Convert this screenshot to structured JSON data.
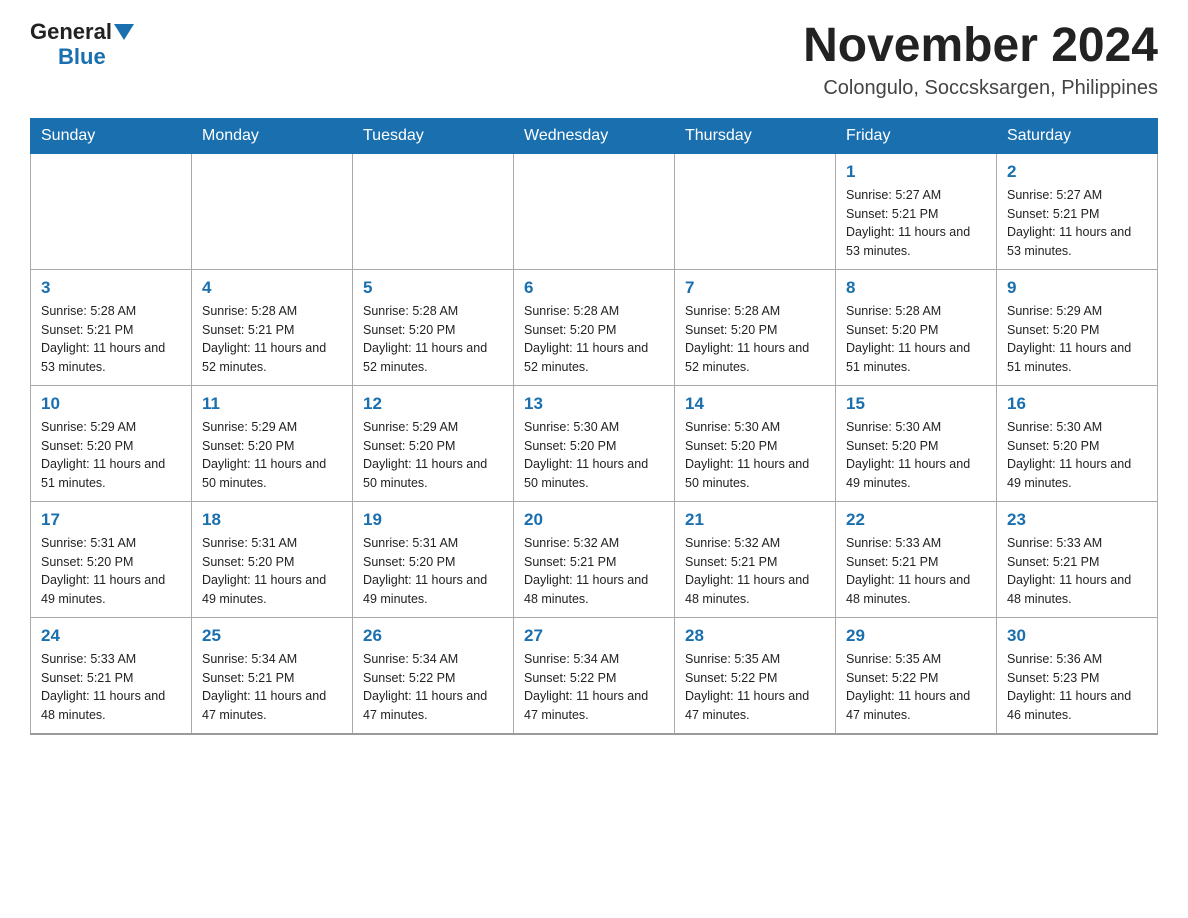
{
  "header": {
    "logo": {
      "general": "General",
      "triangle_alt": "blue triangle",
      "blue": "Blue"
    },
    "title": "November 2024",
    "location": "Colongulo, Soccsksargen, Philippines"
  },
  "calendar": {
    "days_of_week": [
      "Sunday",
      "Monday",
      "Tuesday",
      "Wednesday",
      "Thursday",
      "Friday",
      "Saturday"
    ],
    "weeks": [
      [
        {
          "day": "",
          "sunrise": "",
          "sunset": "",
          "daylight": ""
        },
        {
          "day": "",
          "sunrise": "",
          "sunset": "",
          "daylight": ""
        },
        {
          "day": "",
          "sunrise": "",
          "sunset": "",
          "daylight": ""
        },
        {
          "day": "",
          "sunrise": "",
          "sunset": "",
          "daylight": ""
        },
        {
          "day": "",
          "sunrise": "",
          "sunset": "",
          "daylight": ""
        },
        {
          "day": "1",
          "sunrise": "Sunrise: 5:27 AM",
          "sunset": "Sunset: 5:21 PM",
          "daylight": "Daylight: 11 hours and 53 minutes."
        },
        {
          "day": "2",
          "sunrise": "Sunrise: 5:27 AM",
          "sunset": "Sunset: 5:21 PM",
          "daylight": "Daylight: 11 hours and 53 minutes."
        }
      ],
      [
        {
          "day": "3",
          "sunrise": "Sunrise: 5:28 AM",
          "sunset": "Sunset: 5:21 PM",
          "daylight": "Daylight: 11 hours and 53 minutes."
        },
        {
          "day": "4",
          "sunrise": "Sunrise: 5:28 AM",
          "sunset": "Sunset: 5:21 PM",
          "daylight": "Daylight: 11 hours and 52 minutes."
        },
        {
          "day": "5",
          "sunrise": "Sunrise: 5:28 AM",
          "sunset": "Sunset: 5:20 PM",
          "daylight": "Daylight: 11 hours and 52 minutes."
        },
        {
          "day": "6",
          "sunrise": "Sunrise: 5:28 AM",
          "sunset": "Sunset: 5:20 PM",
          "daylight": "Daylight: 11 hours and 52 minutes."
        },
        {
          "day": "7",
          "sunrise": "Sunrise: 5:28 AM",
          "sunset": "Sunset: 5:20 PM",
          "daylight": "Daylight: 11 hours and 52 minutes."
        },
        {
          "day": "8",
          "sunrise": "Sunrise: 5:28 AM",
          "sunset": "Sunset: 5:20 PM",
          "daylight": "Daylight: 11 hours and 51 minutes."
        },
        {
          "day": "9",
          "sunrise": "Sunrise: 5:29 AM",
          "sunset": "Sunset: 5:20 PM",
          "daylight": "Daylight: 11 hours and 51 minutes."
        }
      ],
      [
        {
          "day": "10",
          "sunrise": "Sunrise: 5:29 AM",
          "sunset": "Sunset: 5:20 PM",
          "daylight": "Daylight: 11 hours and 51 minutes."
        },
        {
          "day": "11",
          "sunrise": "Sunrise: 5:29 AM",
          "sunset": "Sunset: 5:20 PM",
          "daylight": "Daylight: 11 hours and 50 minutes."
        },
        {
          "day": "12",
          "sunrise": "Sunrise: 5:29 AM",
          "sunset": "Sunset: 5:20 PM",
          "daylight": "Daylight: 11 hours and 50 minutes."
        },
        {
          "day": "13",
          "sunrise": "Sunrise: 5:30 AM",
          "sunset": "Sunset: 5:20 PM",
          "daylight": "Daylight: 11 hours and 50 minutes."
        },
        {
          "day": "14",
          "sunrise": "Sunrise: 5:30 AM",
          "sunset": "Sunset: 5:20 PM",
          "daylight": "Daylight: 11 hours and 50 minutes."
        },
        {
          "day": "15",
          "sunrise": "Sunrise: 5:30 AM",
          "sunset": "Sunset: 5:20 PM",
          "daylight": "Daylight: 11 hours and 49 minutes."
        },
        {
          "day": "16",
          "sunrise": "Sunrise: 5:30 AM",
          "sunset": "Sunset: 5:20 PM",
          "daylight": "Daylight: 11 hours and 49 minutes."
        }
      ],
      [
        {
          "day": "17",
          "sunrise": "Sunrise: 5:31 AM",
          "sunset": "Sunset: 5:20 PM",
          "daylight": "Daylight: 11 hours and 49 minutes."
        },
        {
          "day": "18",
          "sunrise": "Sunrise: 5:31 AM",
          "sunset": "Sunset: 5:20 PM",
          "daylight": "Daylight: 11 hours and 49 minutes."
        },
        {
          "day": "19",
          "sunrise": "Sunrise: 5:31 AM",
          "sunset": "Sunset: 5:20 PM",
          "daylight": "Daylight: 11 hours and 49 minutes."
        },
        {
          "day": "20",
          "sunrise": "Sunrise: 5:32 AM",
          "sunset": "Sunset: 5:21 PM",
          "daylight": "Daylight: 11 hours and 48 minutes."
        },
        {
          "day": "21",
          "sunrise": "Sunrise: 5:32 AM",
          "sunset": "Sunset: 5:21 PM",
          "daylight": "Daylight: 11 hours and 48 minutes."
        },
        {
          "day": "22",
          "sunrise": "Sunrise: 5:33 AM",
          "sunset": "Sunset: 5:21 PM",
          "daylight": "Daylight: 11 hours and 48 minutes."
        },
        {
          "day": "23",
          "sunrise": "Sunrise: 5:33 AM",
          "sunset": "Sunset: 5:21 PM",
          "daylight": "Daylight: 11 hours and 48 minutes."
        }
      ],
      [
        {
          "day": "24",
          "sunrise": "Sunrise: 5:33 AM",
          "sunset": "Sunset: 5:21 PM",
          "daylight": "Daylight: 11 hours and 48 minutes."
        },
        {
          "day": "25",
          "sunrise": "Sunrise: 5:34 AM",
          "sunset": "Sunset: 5:21 PM",
          "daylight": "Daylight: 11 hours and 47 minutes."
        },
        {
          "day": "26",
          "sunrise": "Sunrise: 5:34 AM",
          "sunset": "Sunset: 5:22 PM",
          "daylight": "Daylight: 11 hours and 47 minutes."
        },
        {
          "day": "27",
          "sunrise": "Sunrise: 5:34 AM",
          "sunset": "Sunset: 5:22 PM",
          "daylight": "Daylight: 11 hours and 47 minutes."
        },
        {
          "day": "28",
          "sunrise": "Sunrise: 5:35 AM",
          "sunset": "Sunset: 5:22 PM",
          "daylight": "Daylight: 11 hours and 47 minutes."
        },
        {
          "day": "29",
          "sunrise": "Sunrise: 5:35 AM",
          "sunset": "Sunset: 5:22 PM",
          "daylight": "Daylight: 11 hours and 47 minutes."
        },
        {
          "day": "30",
          "sunrise": "Sunrise: 5:36 AM",
          "sunset": "Sunset: 5:23 PM",
          "daylight": "Daylight: 11 hours and 46 minutes."
        }
      ]
    ]
  }
}
